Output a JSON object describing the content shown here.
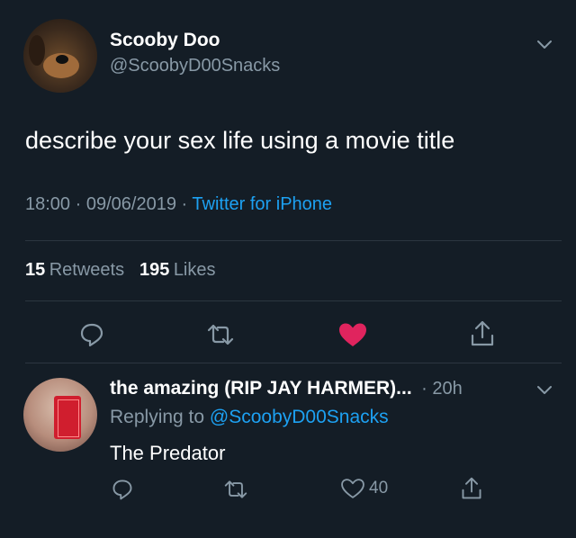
{
  "tweet": {
    "author_name": "Scooby Doo",
    "author_handle": "@ScoobyD00Snacks",
    "text": "describe your sex life using a movie title",
    "time": "18:00",
    "date": "09/06/2019",
    "source": "Twitter for iPhone",
    "retweets_count": "15",
    "retweets_label": "Retweets",
    "likes_count": "195",
    "likes_label": "Likes",
    "sep": "·"
  },
  "reply": {
    "author_name": "the amazing (RIP JAY HARMER)...",
    "age": "· 20h",
    "replying_to_label": "Replying to",
    "replying_to_handle": "@ScoobyD00Snacks",
    "text": "The Predator",
    "like_count": "40"
  },
  "colors": {
    "background": "#141d26",
    "accent": "#1da1f2",
    "like": "#e0245e",
    "muted": "#8899a6"
  },
  "icons": [
    "chevron-down-icon",
    "reply-icon",
    "retweet-icon",
    "heart-filled-icon",
    "share-icon",
    "heart-outline-icon"
  ]
}
